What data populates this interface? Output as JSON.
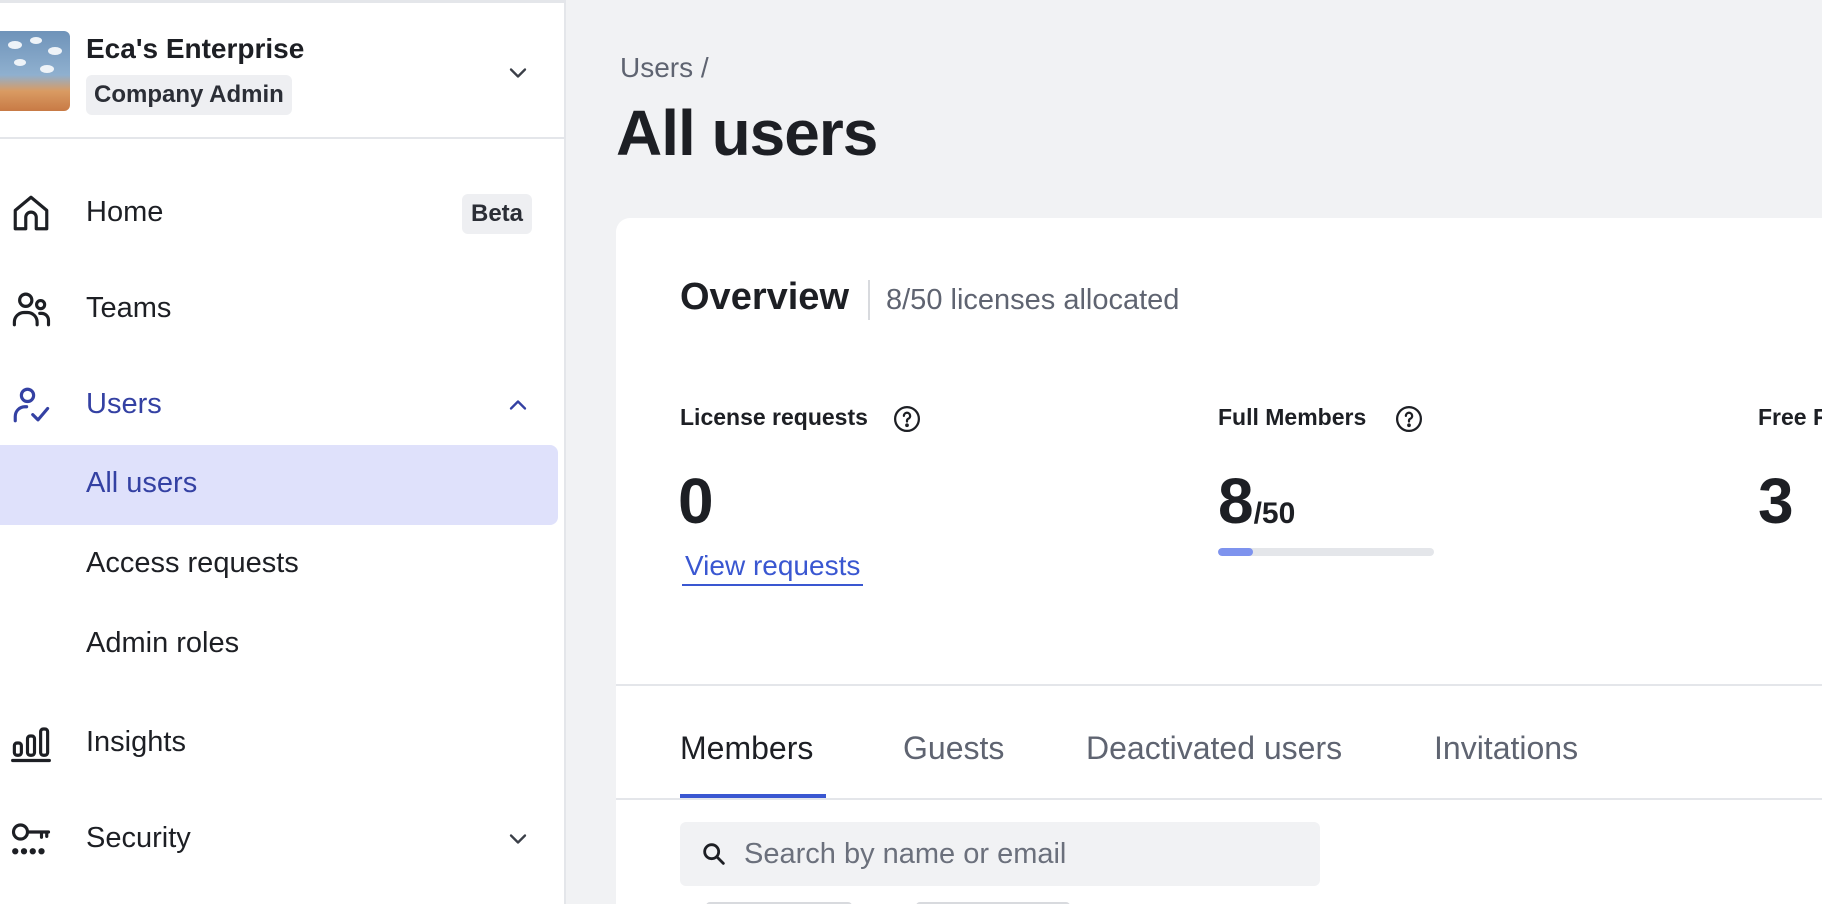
{
  "org": {
    "name": "Eca's Enterprise",
    "role": "Company Admin"
  },
  "nav": {
    "home": {
      "label": "Home",
      "badge": "Beta"
    },
    "teams": {
      "label": "Teams"
    },
    "users": {
      "label": "Users",
      "sub_items": [
        {
          "label": "All users",
          "active": true
        },
        {
          "label": "Access requests",
          "active": false
        },
        {
          "label": "Admin roles",
          "active": false
        }
      ]
    },
    "insights": {
      "label": "Insights"
    },
    "security": {
      "label": "Security"
    }
  },
  "breadcrumb": "Users /",
  "page_title": "All users",
  "overview": {
    "title": "Overview",
    "subtitle": "8/50 licenses allocated",
    "stats": {
      "license_requests": {
        "label": "License requests",
        "value": "0",
        "link": "View requests"
      },
      "full_members": {
        "label": "Full Members",
        "value": "8",
        "denominator": "/50",
        "progress": 0.16
      },
      "free": {
        "label": "Free F",
        "value": "3"
      }
    }
  },
  "tabs": [
    {
      "label": "Members",
      "active": true
    },
    {
      "label": "Guests",
      "active": false
    },
    {
      "label": "Deactivated users",
      "active": false
    },
    {
      "label": "Invitations",
      "active": false
    }
  ],
  "search": {
    "placeholder": "Search by name or email",
    "value": ""
  },
  "colors": {
    "accent": "#3a57d1",
    "active_nav_bg": "#dfe1fb",
    "active_nav_text": "#3441a3",
    "progress_fill": "#7e93ee"
  }
}
